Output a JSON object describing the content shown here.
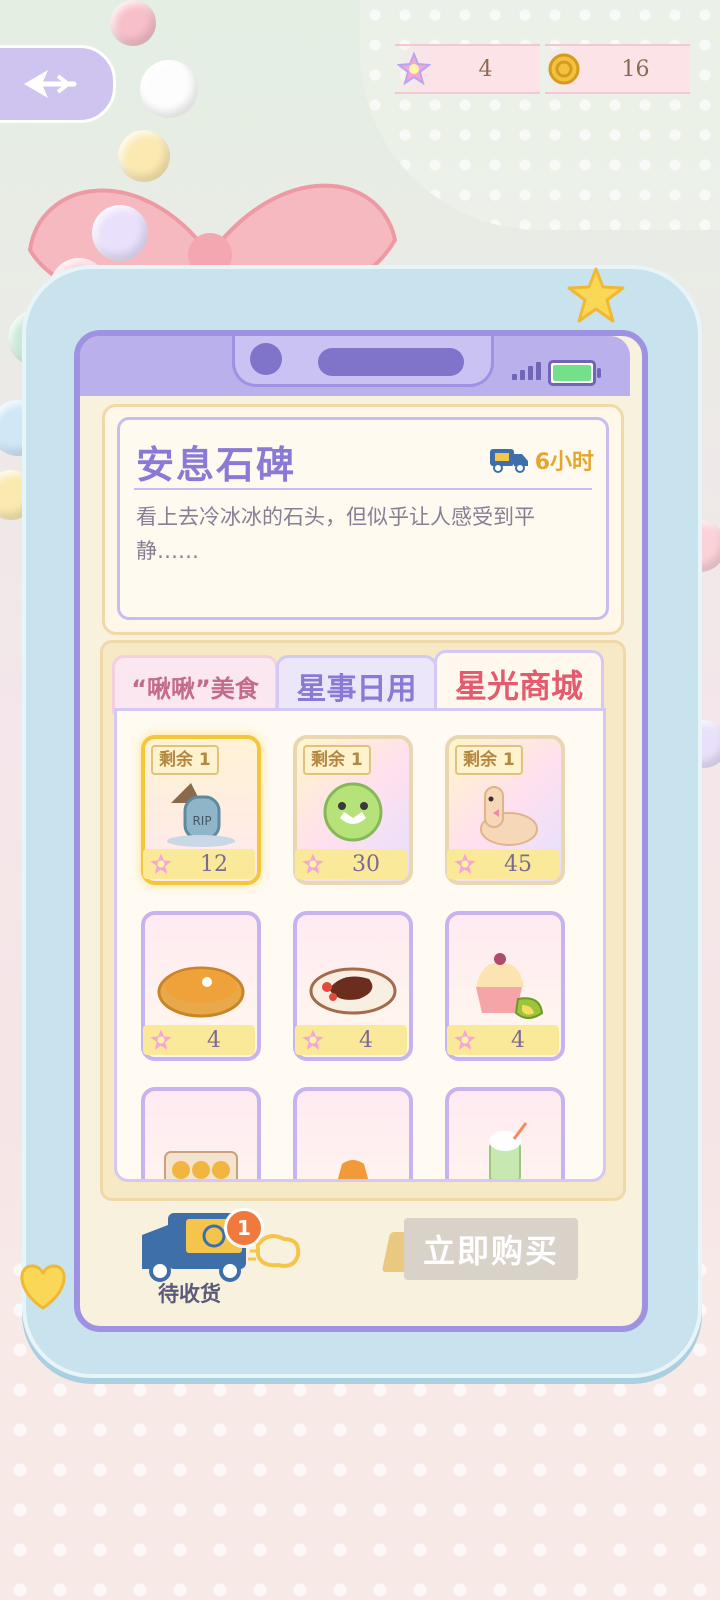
{
  "currencies": [
    {
      "icon": "star-gem-icon",
      "value": "4"
    },
    {
      "icon": "gold-coin-icon",
      "value": "16"
    }
  ],
  "item": {
    "title": "安息石碑",
    "delivery_time": "6小时",
    "description": "看上去冷冰冰的石头，但似乎让人感受到平静……"
  },
  "tabs": [
    {
      "label": "“啾啾”美食",
      "active": false
    },
    {
      "label": "星事日用",
      "active": false
    },
    {
      "label": "星光商城",
      "active": true
    }
  ],
  "shop_items": [
    {
      "stock": "剩余 1",
      "price": "12",
      "icon": "rip-tombstone-icon",
      "selected": true
    },
    {
      "stock": "剩余 1",
      "price": "30",
      "icon": "green-orb-icon",
      "selected": false
    },
    {
      "stock": "剩余 1",
      "price": "45",
      "icon": "alpaca-plush-icon",
      "selected": false
    },
    {
      "stock": "",
      "price": "4",
      "icon": "pumpkin-pie-icon",
      "selected": false
    },
    {
      "stock": "",
      "price": "4",
      "icon": "steak-plate-icon",
      "selected": false
    },
    {
      "stock": "",
      "price": "4",
      "icon": "durian-shaved-ice-icon",
      "selected": false
    },
    {
      "stock": "",
      "price": "",
      "icon": "egg-tarts-icon",
      "selected": false
    },
    {
      "stock": "",
      "price": "",
      "icon": "pudding-icon",
      "selected": false
    },
    {
      "stock": "",
      "price": "",
      "icon": "matcha-drink-icon",
      "selected": false
    }
  ],
  "footer": {
    "pending_label": "待收货",
    "pending_count": "1",
    "buy_label": "立即购买"
  },
  "colors": {
    "accent_purple": "#8a7ad6",
    "active_tab": "#e45b6d",
    "delivery": "#e6a62d"
  }
}
